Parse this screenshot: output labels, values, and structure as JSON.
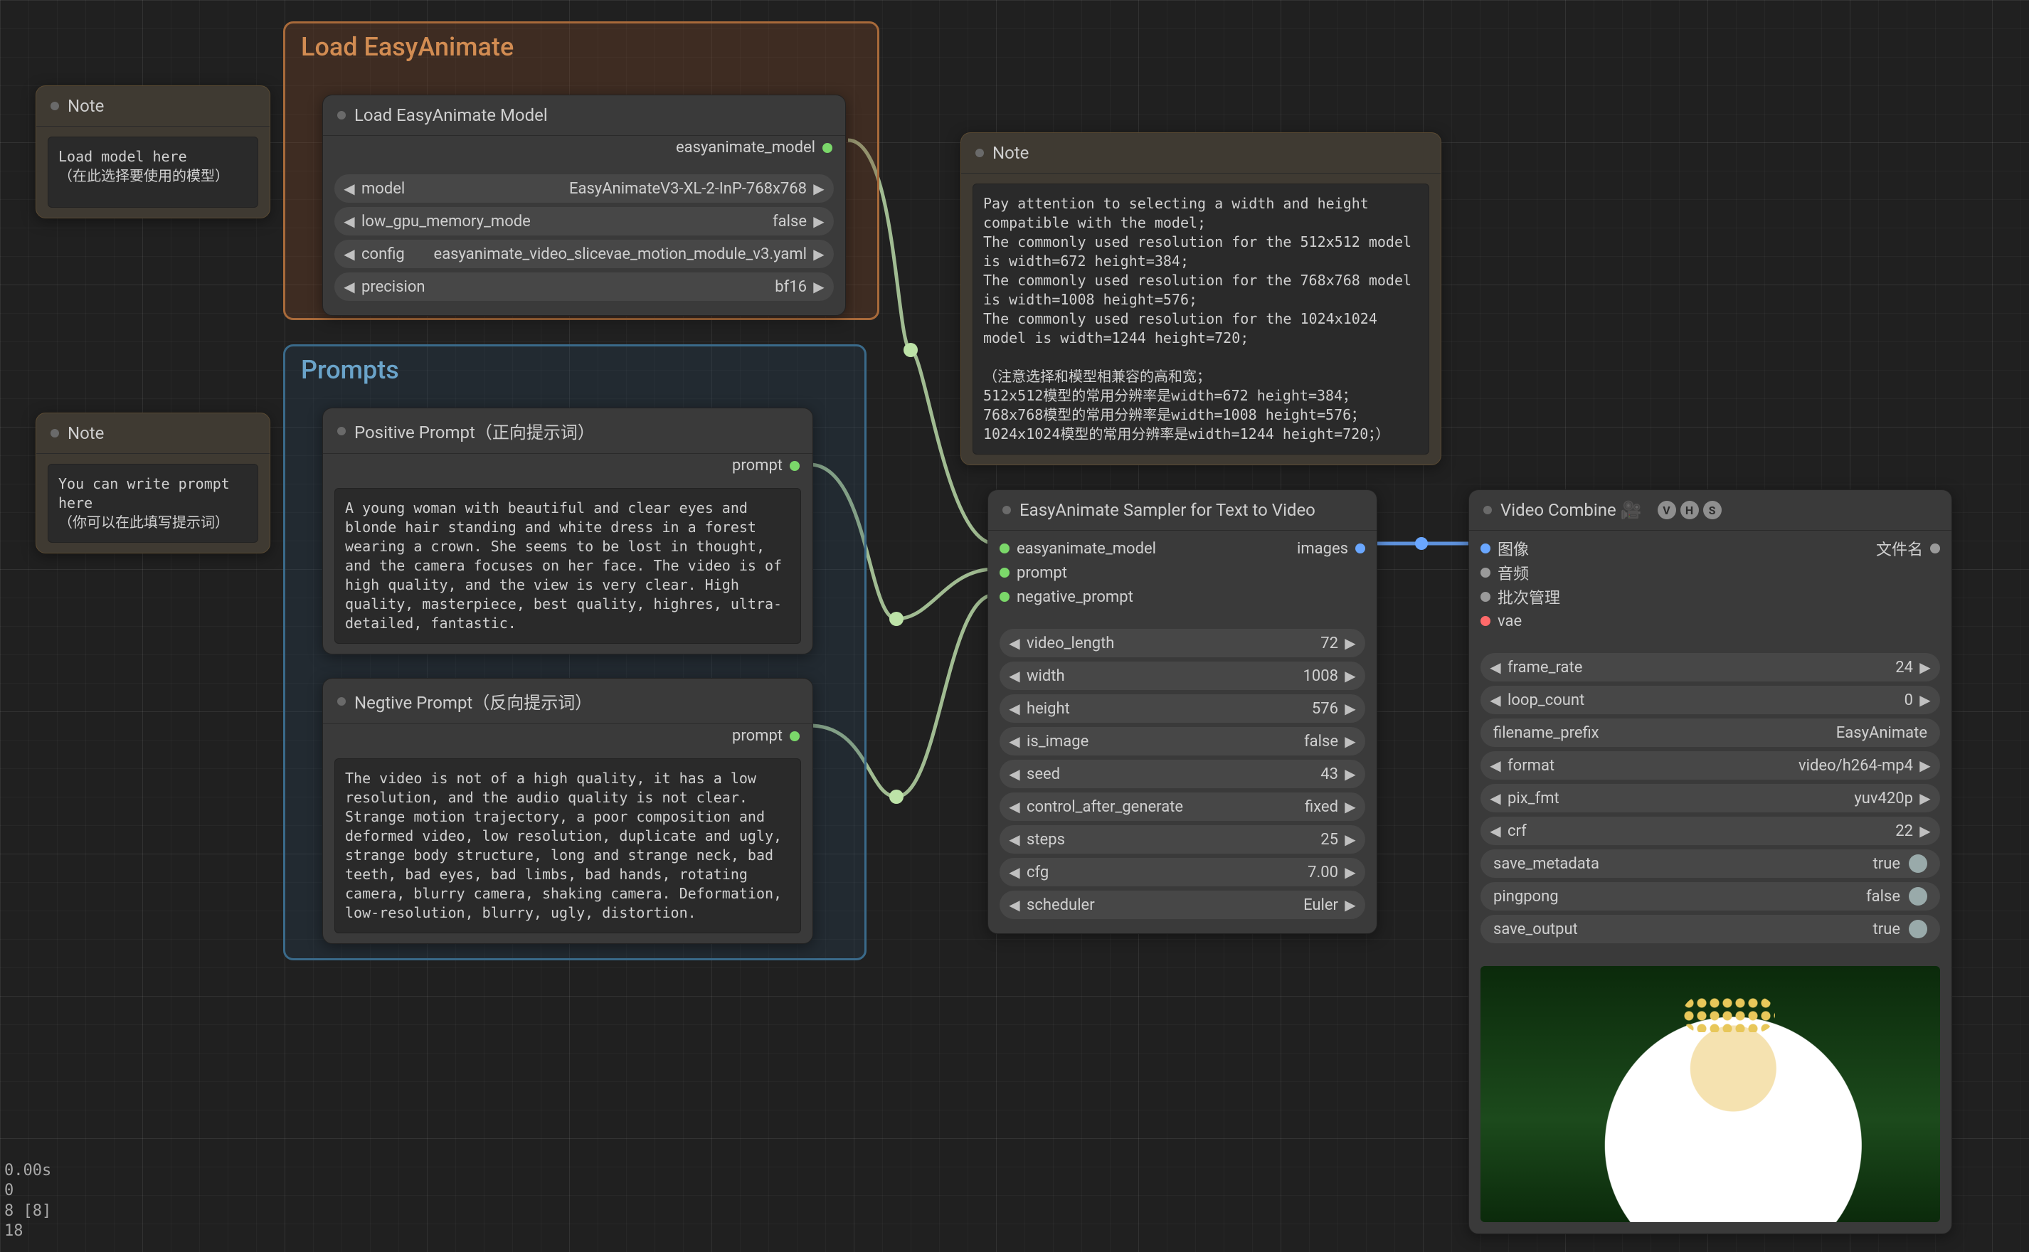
{
  "stats": {
    "l1": "0.00s",
    "l2": "0",
    "l3": "8 [8]",
    "l4": "18"
  },
  "noteLeft1": {
    "title": "Note",
    "text": "Load model here\n（在此选择要使用的模型）"
  },
  "noteLeft2": {
    "title": "Note",
    "text": "You can write prompt here\n（你可以在此填写提示词）"
  },
  "groupLoad": {
    "title": "Load EasyAnimate",
    "sub": "Load EasyAnimate Model"
  },
  "loadNode": {
    "out": "easyanimate_model",
    "rows": [
      {
        "label": "model",
        "value": "EasyAnimateV3-XL-2-InP-768x768"
      },
      {
        "label": "low_gpu_memory_mode",
        "value": "false"
      },
      {
        "label": "config",
        "value": "easyanimate_video_slicevae_motion_module_v3.yaml"
      },
      {
        "label": "precision",
        "value": "bf16"
      }
    ]
  },
  "groupPrompts": {
    "title": "Prompts",
    "pos": {
      "title": "Positive Prompt（正向提示词）",
      "out": "prompt",
      "text": "A young woman with beautiful and clear eyes and blonde hair standing and white dress in a forest wearing a crown. She seems to be lost in thought, and the camera focuses on her face. The video is of high quality, and the view is very clear. High quality, masterpiece, best quality, highres, ultra-detailed, fantastic."
    },
    "neg": {
      "title": "Negtive Prompt（反向提示词）",
      "out": "prompt",
      "text": "The video is not of a high quality, it has a low resolution, and the audio quality is not clear. Strange motion trajectory, a poor composition and deformed video, low resolution, duplicate and ugly, strange body structure, long and strange neck, bad teeth, bad eyes, bad limbs, bad hands, rotating camera, blurry camera, shaking camera. Deformation, low-resolution, blurry, ugly, distortion."
    }
  },
  "noteRight": {
    "title": "Note",
    "text": "Pay attention to selecting a width and height compatible with the model;\nThe commonly used resolution for the 512x512 model is width=672 height=384;\nThe commonly used resolution for the 768x768 model is width=1008 height=576;\nThe commonly used resolution for the 1024x1024 model is width=1244 height=720;\n\n（注意选择和模型相兼容的高和宽；\n512x512模型的常用分辨率是width=672 height=384；\n768x768模型的常用分辨率是width=1008 height=576；\n1024x1024模型的常用分辨率是width=1244 height=720；）"
  },
  "sampler": {
    "title": "EasyAnimate Sampler for Text to Video",
    "in": [
      "easyanimate_model",
      "prompt",
      "negative_prompt"
    ],
    "out": "images",
    "rows": [
      {
        "label": "video_length",
        "value": "72"
      },
      {
        "label": "width",
        "value": "1008"
      },
      {
        "label": "height",
        "value": "576"
      },
      {
        "label": "is_image",
        "value": "false"
      },
      {
        "label": "seed",
        "value": "43"
      },
      {
        "label": "control_after_generate",
        "value": "fixed"
      },
      {
        "label": "steps",
        "value": "25"
      },
      {
        "label": "cfg",
        "value": "7.00"
      },
      {
        "label": "scheduler",
        "value": "Euler"
      }
    ]
  },
  "combine": {
    "title": "Video Combine 🎥",
    "vhs": [
      "V",
      "H",
      "S"
    ],
    "in": [
      {
        "label": "图像",
        "color": "c-blue"
      },
      {
        "label": "音频",
        "color": "c-grey"
      },
      {
        "label": "批次管理",
        "color": "c-grey"
      },
      {
        "label": "vae",
        "color": "c-red"
      }
    ],
    "out": "文件名",
    "rows": [
      {
        "type": "arrow",
        "label": "frame_rate",
        "value": "24"
      },
      {
        "type": "arrow",
        "label": "loop_count",
        "value": "0"
      },
      {
        "type": "flat",
        "label": "filename_prefix",
        "value": "EasyAnimate"
      },
      {
        "type": "arrow",
        "label": "format",
        "value": "video/h264-mp4"
      },
      {
        "type": "arrow",
        "label": "pix_fmt",
        "value": "yuv420p"
      },
      {
        "type": "arrow",
        "label": "crf",
        "value": "22"
      },
      {
        "type": "toggle",
        "label": "save_metadata",
        "value": "true"
      },
      {
        "type": "toggle",
        "label": "pingpong",
        "value": "false"
      },
      {
        "type": "toggle",
        "label": "save_output",
        "value": "true"
      }
    ]
  }
}
